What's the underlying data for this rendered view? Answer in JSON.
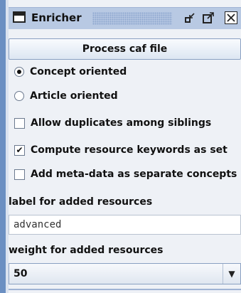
{
  "window": {
    "title": "Enricher"
  },
  "actions": {
    "process_label": "Process caf file"
  },
  "orientation": {
    "options": [
      {
        "label": "Concept oriented",
        "selected": true
      },
      {
        "label": "Article oriented",
        "selected": false
      }
    ]
  },
  "checkboxes": [
    {
      "label": "Allow duplicates among siblings",
      "checked": false
    },
    {
      "label": "Compute resource keywords as set",
      "checked": true
    },
    {
      "label": "Add meta-data as separate concepts",
      "checked": false
    }
  ],
  "label_field": {
    "label": "label for added resources",
    "value": "advanced"
  },
  "weight_field": {
    "label": "weight for added resources",
    "value": "50"
  },
  "icons": {
    "window": "window-icon",
    "iconify": "iconify-icon",
    "maximize": "maximize-icon",
    "close": "close-icon",
    "dropdown": "chevron-down-icon",
    "checkmark": "checkmark-icon"
  }
}
